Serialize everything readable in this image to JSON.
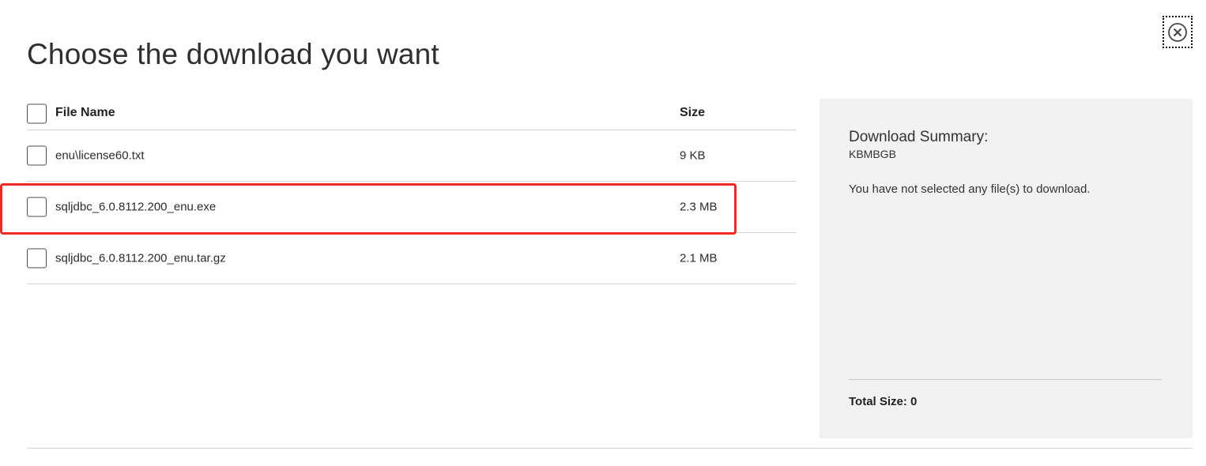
{
  "dialog": {
    "title": "Choose the download you want"
  },
  "table": {
    "headers": {
      "file_name": "File Name",
      "size": "Size"
    },
    "rows": [
      {
        "name": "enu\\license60.txt",
        "size": "9 KB",
        "checked": false
      },
      {
        "name": "sqljdbc_6.0.8112.200_enu.exe",
        "size": "2.3 MB",
        "checked": false,
        "highlighted": true
      },
      {
        "name": "sqljdbc_6.0.8112.200_enu.tar.gz",
        "size": "2.1 MB",
        "checked": false
      }
    ]
  },
  "summary": {
    "title": "Download Summary:",
    "subtitle": "KBMBGB",
    "message": "You have not selected any file(s) to download.",
    "total_label": "Total Size: 0"
  },
  "colors": {
    "highlight": "#ee2a24",
    "panel_bg": "#f2f2f2"
  }
}
